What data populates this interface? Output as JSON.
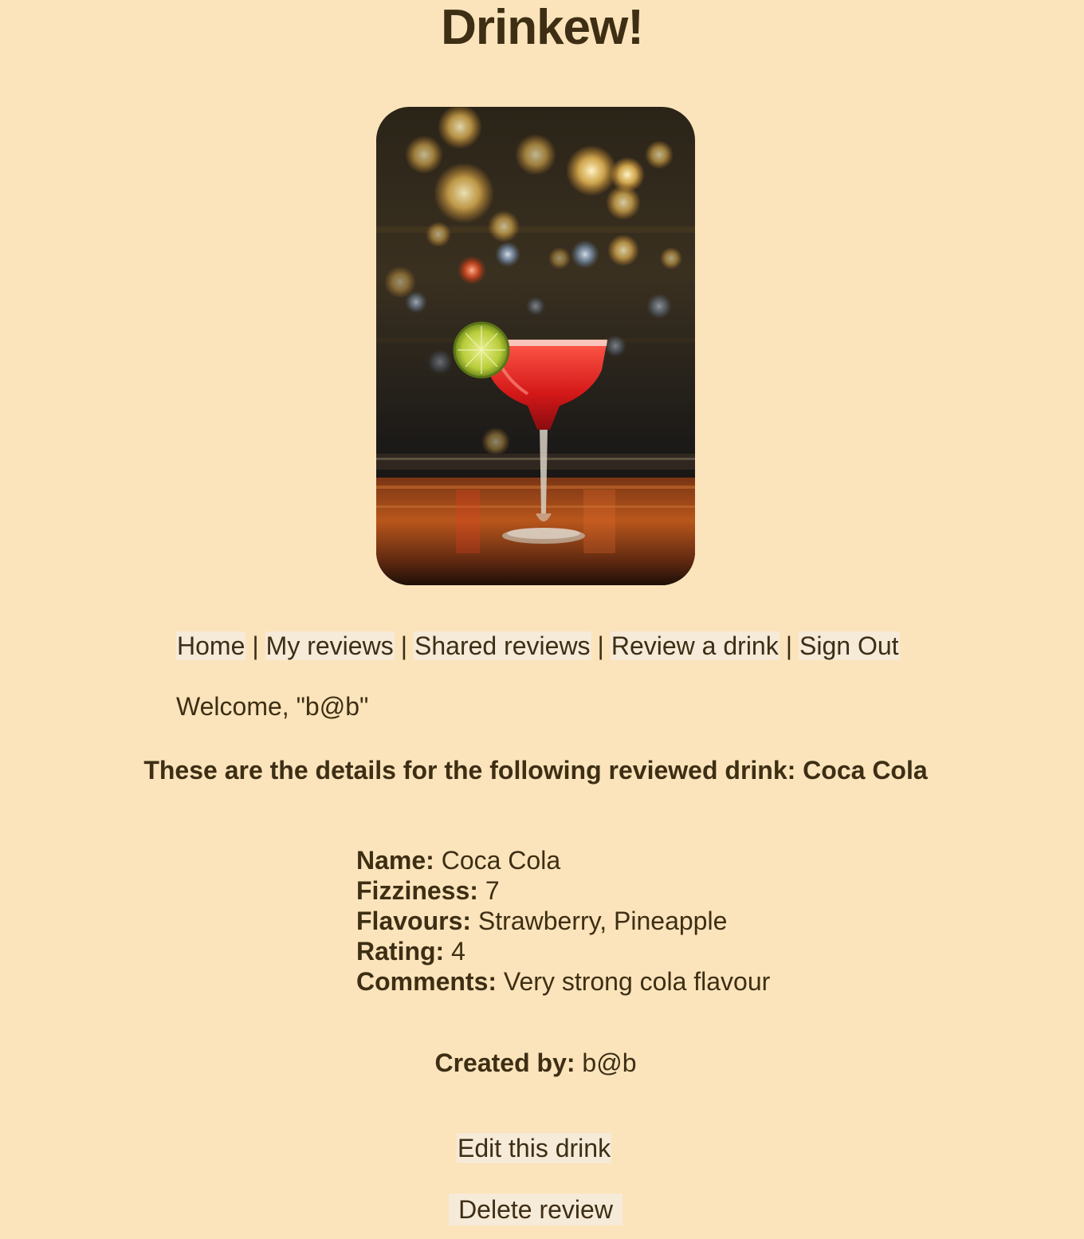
{
  "header": {
    "title": "Drinkew!"
  },
  "hero_image": {
    "alt": "Red margarita cocktail with lime on a bar counter"
  },
  "nav": {
    "items": [
      {
        "label": "Home"
      },
      {
        "label": "My reviews"
      },
      {
        "label": "Shared reviews"
      },
      {
        "label": "Review a drink"
      },
      {
        "label": "Sign Out"
      }
    ],
    "separator": "|"
  },
  "welcome": {
    "text": "Welcome, \"b@b\""
  },
  "details": {
    "heading": "These are the details for the following reviewed drink: Coca Cola",
    "fields": [
      {
        "label": "Name:",
        "value": "Coca Cola"
      },
      {
        "label": "Fizziness:",
        "value": "7"
      },
      {
        "label": "Flavours:",
        "value": "Strawberry, Pineapple"
      },
      {
        "label": "Rating:",
        "value": "4"
      },
      {
        "label": "Comments:",
        "value": "Very strong cola flavour"
      }
    ],
    "created_by_label": "Created by:",
    "created_by_value": "b@b"
  },
  "actions": {
    "edit_label": "Edit this drink",
    "delete_label": "Delete review"
  },
  "colors": {
    "background": "#fbe4bb",
    "text": "#3d2e14",
    "link_bg": "#f6ead9"
  }
}
